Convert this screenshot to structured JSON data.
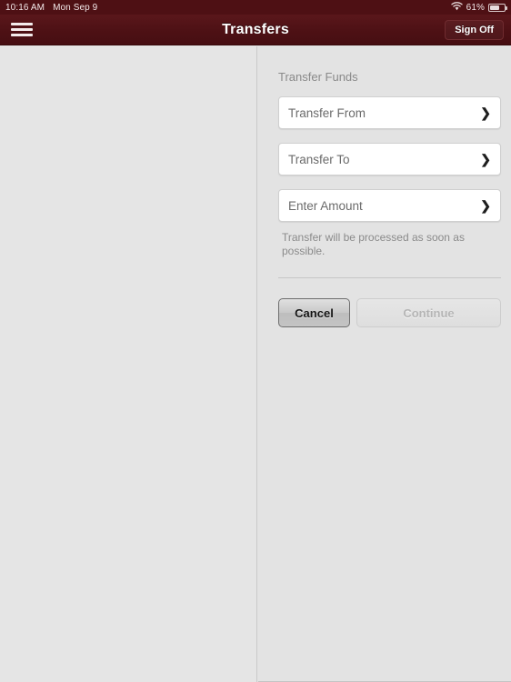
{
  "status_bar": {
    "time": "10:16 AM",
    "date": "Mon Sep 9",
    "battery_percent": "61%",
    "wifi_icon": "wifi-icon",
    "battery_icon": "battery-icon"
  },
  "nav_bar": {
    "menu_icon": "hamburger-menu-icon",
    "title": "Transfers",
    "sign_off_label": "Sign Off"
  },
  "form": {
    "section_title": "Transfer Funds",
    "fields": [
      {
        "label": "Transfer From",
        "chevron": "❯"
      },
      {
        "label": "Transfer To",
        "chevron": "❯"
      },
      {
        "label": "Enter Amount",
        "chevron": "❯"
      }
    ],
    "helper_text": "Transfer will be processed as soon as possible.",
    "cancel_label": "Cancel",
    "continue_label": "Continue"
  },
  "colors": {
    "nav_bar": "#4e1115",
    "background": "#e4e4e4",
    "field_background": "#ffffff",
    "label_text": "#6b6b6b",
    "muted_text": "#8a8a8a"
  }
}
